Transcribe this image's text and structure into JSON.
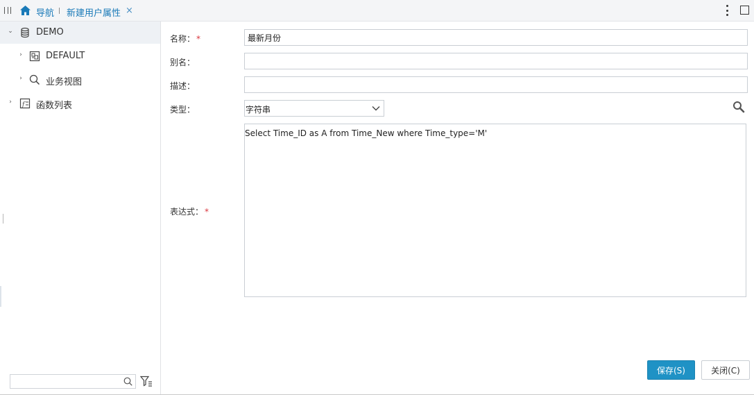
{
  "header": {
    "nav_label": "导航",
    "tab_label": "新建用户属性",
    "tab_close": "×"
  },
  "tree": {
    "items": [
      {
        "label": "DEMO",
        "expanded": true,
        "icon": "database-icon",
        "selected": true
      },
      {
        "label": "DEFAULT",
        "expanded": false,
        "icon": "schema-icon"
      },
      {
        "label": "业务视图",
        "expanded": false,
        "icon": "search-icon"
      },
      {
        "label": "函数列表",
        "expanded": false,
        "icon": "function-list-icon"
      }
    ]
  },
  "filter": {
    "placeholder": "",
    "value": ""
  },
  "form": {
    "name_label": "名称：",
    "name_required": "*",
    "name_value": "最新月份",
    "alias_label": "别名：",
    "alias_value": "",
    "desc_label": "描述：",
    "desc_value": "",
    "type_label": "类型：",
    "type_value": "字符串",
    "expr_label": "表达式：",
    "expr_required": "*",
    "expr_value": "Select Time_ID as A from Time_New where Time_type='M'"
  },
  "buttons": {
    "save": "保存(S)",
    "close": "关闭(C)"
  },
  "colors": {
    "accent": "#1f92c5",
    "link": "#1a7ab8",
    "required": "#d9363e"
  }
}
